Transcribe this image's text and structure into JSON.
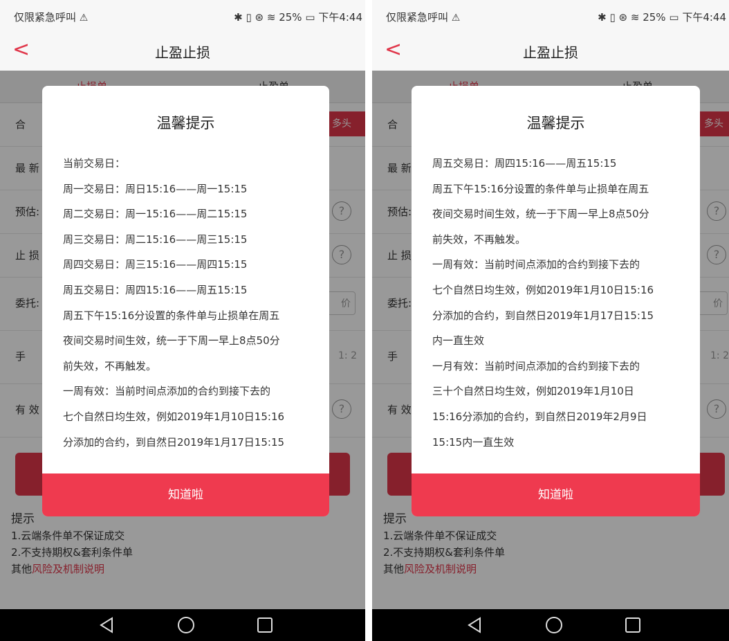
{
  "status_bar": {
    "carrier": "仅限紧急呼叫",
    "warning_glyph": "⚠",
    "indicators": "✱ ▯ ⊛ ≋",
    "battery": "25%",
    "time": "下午4:44"
  },
  "header": {
    "title": "止盈止损",
    "back_glyph": "<"
  },
  "tabs": [
    "止损单",
    "止盈单"
  ],
  "form_rows_left": [
    {
      "label": "合",
      "extra": "多头"
    },
    {
      "label": "最 新"
    },
    {
      "label": "预估:"
    },
    {
      "label": "止 损"
    },
    {
      "label": "委托:",
      "extra": "价"
    },
    {
      "label": "手",
      "extra": "1: 2"
    },
    {
      "label": "有 效"
    }
  ],
  "form_rows_right": [
    {
      "label": "合",
      "extra": "多头"
    },
    {
      "label": "最 新"
    },
    {
      "label": "预估:"
    },
    {
      "label": "止 损"
    },
    {
      "label": "委托:",
      "extra": "价"
    },
    {
      "label": "手",
      "extra": "1: 2"
    },
    {
      "label": "有 效"
    }
  ],
  "help_glyph": "?",
  "tips": {
    "title": "提示",
    "line1": "1.云端条件单不保证成交",
    "line2": "2.不支持期权&套利条件单",
    "other_prefix": "其他",
    "other_link": "风险及机制说明"
  },
  "dialog_left": {
    "title": "温馨提示",
    "lines": [
      "当前交易日：",
      "周一交易日：周日15:16——周一15:15",
      "周二交易日：周一15:16——周二15:15",
      "周三交易日：周二15:16——周三15:15",
      "周四交易日：周三15:16——周四15:15",
      "周五交易日：周四15:16——周五15:15",
      "周五下午15:16分设置的条件单与止损单在周五",
      "夜间交易时间生效，统一于下周一早上8点50分",
      "前失效，不再触发。",
      "一周有效：当前时间点添加的合约到接下去的",
      "七个自然日均生效，例如2019年1月10日15:16",
      "分添加的合约，到自然日2019年1月17日15:15"
    ],
    "button": "知道啦"
  },
  "dialog_right": {
    "title": "温馨提示",
    "lines": [
      "周五交易日：周四15:16——周五15:15",
      "周五下午15:16分设置的条件单与止损单在周五",
      "夜间交易时间生效，统一于下周一早上8点50分",
      "前失效，不再触发。",
      "一周有效：当前时间点添加的合约到接下去的",
      "七个自然日均生效，例如2019年1月10日15:16",
      "分添加的合约，到自然日2019年1月17日15:15",
      "内一直生效",
      "一月有效：当前时间点添加的合约到接下去的",
      "三十个自然日均生效，例如2019年1月10日",
      "15:16分添加的合约，到自然日2019年2月9日",
      "15:15内一直生效"
    ],
    "button": "知道啦"
  },
  "colors": {
    "accent": "#e0364a",
    "dialog_button": "#ef3a4f"
  }
}
